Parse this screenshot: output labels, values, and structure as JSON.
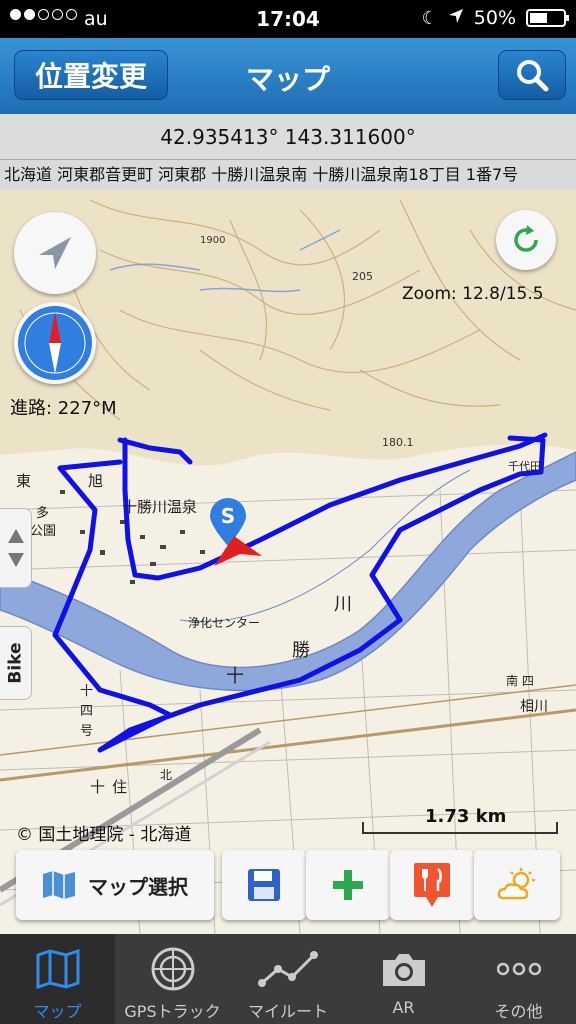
{
  "status_bar": {
    "carrier": "au",
    "time": "17:04",
    "battery": "50%",
    "signal_bars_filled": 2,
    "signal_bars_total": 5
  },
  "nav": {
    "left_button": "位置変更",
    "title": "マップ",
    "search_icon": "search-icon"
  },
  "location": {
    "coordinates": "42.935413° 143.311600°",
    "address": "北海道 河東郡音更町 河東郡 十勝川温泉南 十勝川温泉南18丁目 1番7号"
  },
  "map": {
    "zoom": "Zoom: 12.8/15.5",
    "heading": "進路: 227°M",
    "bike_tab": "Bike",
    "scale": "1.73 km",
    "attribution": "© 国土地理院 - 北海道",
    "start_marker": "S",
    "route_color": "#1010e8",
    "labels": {
      "onsen": "十勝川温泉",
      "jokacenter": "浄化センター",
      "river1": "十",
      "river2": "勝",
      "river3": "川",
      "chiyoda": "千代田",
      "higashi": "東",
      "asahi": "旭",
      "juuyon": "十",
      "yonju": "四",
      "go": "号",
      "kon": "十",
      "sumi": "住",
      "aikawa": "相川",
      "minami4": "南 四",
      "hokkai": "北",
      "mark1": "1900",
      "mark2": "205",
      "mark3": "180.1",
      "koen": "公園",
      "ta": "多"
    }
  },
  "toolbar": {
    "map_select": "マップ選択",
    "save_icon": "floppy-icon",
    "add_icon": "plus-icon",
    "restaurant_icon": "restaurant-icon",
    "weather_icon": "weather-icon"
  },
  "tabs": [
    {
      "label": "マップ",
      "icon": "map-icon",
      "active": true
    },
    {
      "label": "GPSトラック",
      "icon": "radar-icon",
      "active": false
    },
    {
      "label": "マイルート",
      "icon": "route-icon",
      "active": false
    },
    {
      "label": "AR",
      "icon": "camera-icon",
      "active": false
    },
    {
      "label": "その他",
      "icon": "more-icon",
      "active": false
    }
  ],
  "colors": {
    "nav_blue": "#1e6db3",
    "active_tab": "#2e8cf0",
    "route": "#1010e8",
    "river": "#7f9bd8",
    "compass_blue": "#2f7ee0"
  }
}
